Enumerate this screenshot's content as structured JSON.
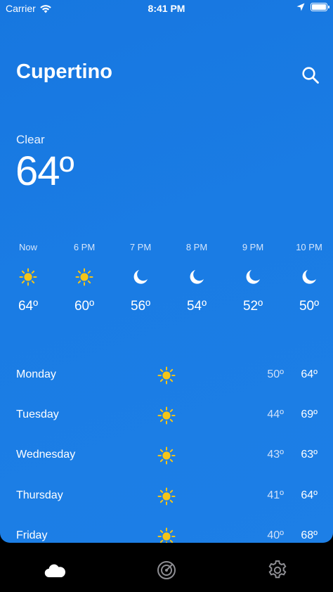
{
  "status_bar": {
    "carrier": "Carrier",
    "time": "8:41 PM"
  },
  "header": {
    "city": "Cupertino"
  },
  "current": {
    "condition": "Clear",
    "temperature": "64º"
  },
  "hourly": [
    {
      "label": "Now",
      "icon": "sun-icon",
      "temp": "64º"
    },
    {
      "label": "6 PM",
      "icon": "sun-icon",
      "temp": "60º"
    },
    {
      "label": "7 PM",
      "icon": "moon-icon",
      "temp": "56º"
    },
    {
      "label": "8 PM",
      "icon": "moon-icon",
      "temp": "54º"
    },
    {
      "label": "9 PM",
      "icon": "moon-icon",
      "temp": "52º"
    },
    {
      "label": "10 PM",
      "icon": "moon-icon",
      "temp": "50º"
    }
  ],
  "daily": [
    {
      "day": "Monday",
      "icon": "sun-icon",
      "low": "50º",
      "high": "64º"
    },
    {
      "day": "Tuesday",
      "icon": "sun-icon",
      "low": "44º",
      "high": "69º"
    },
    {
      "day": "Wednesday",
      "icon": "sun-icon",
      "low": "43º",
      "high": "63º"
    },
    {
      "day": "Thursday",
      "icon": "sun-icon",
      "low": "41º",
      "high": "64º"
    },
    {
      "day": "Friday",
      "icon": "sun-icon",
      "low": "40º",
      "high": "68º"
    }
  ],
  "tabs": [
    {
      "name": "weather",
      "icon": "cloud-icon"
    },
    {
      "name": "radar",
      "icon": "radar-icon"
    },
    {
      "name": "settings",
      "icon": "gear-icon"
    }
  ],
  "colors": {
    "background": "#1a7ce4",
    "sun": "#f5c518",
    "tab_active": "#ffffff",
    "tab_inactive": "#8e8e93"
  }
}
